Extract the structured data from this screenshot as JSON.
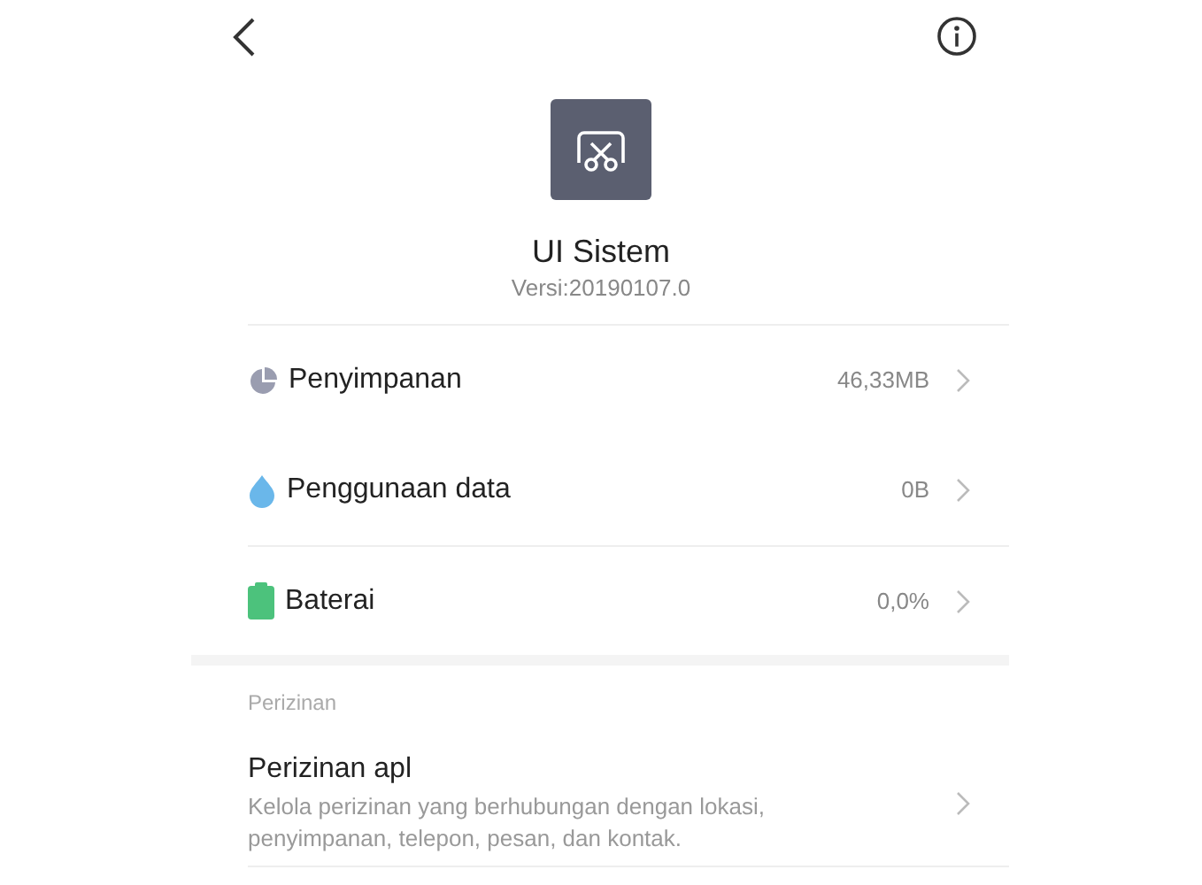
{
  "app": {
    "name": "UI Sistem",
    "version": "Versi:20190107.0"
  },
  "rows": [
    {
      "kind": "storage",
      "label": "Penyimpanan",
      "value": "46,33MB"
    },
    {
      "kind": "data",
      "label": "Penggunaan data",
      "value": "0B"
    },
    {
      "kind": "battery",
      "label": "Baterai",
      "value": "0,0%"
    }
  ],
  "section": {
    "title": "Perizinan",
    "items": [
      {
        "title": "Perizinan apl",
        "description": "Kelola perizinan yang berhubungan dengan lokasi, penyimpanan, telepon, pesan, dan kontak."
      }
    ]
  }
}
